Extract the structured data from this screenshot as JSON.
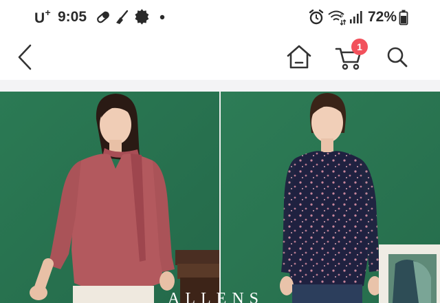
{
  "status_bar": {
    "carrier": "U",
    "carrier_plus": "+",
    "time": "9:05",
    "battery": "72%"
  },
  "nav": {
    "back_icon": "chevron-left-icon",
    "home_icon": "home-icon",
    "cart_icon": "cart-icon",
    "cart_count": "1",
    "search_icon": "search-icon"
  },
  "products": [
    {
      "name": "pink-v-neck-scarf-blouse",
      "image": "model in rose-pink long-sleeve blouse with tie scarf"
    },
    {
      "name": "navy-floral-blouse",
      "image": "model in navy floral print long-sleeve blouse"
    }
  ],
  "brand_partial": "ALLENS",
  "colors": {
    "badge": "#f2515c",
    "backdrop": "#2f7d57",
    "blouse_pink": "#b05a5e",
    "blouse_navy": "#1e1f3a"
  }
}
